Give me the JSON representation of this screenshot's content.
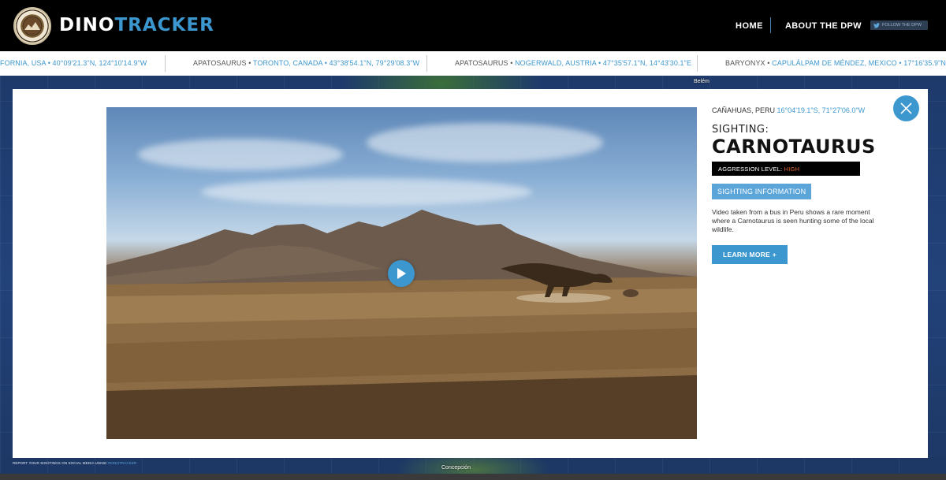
{
  "header": {
    "brand_primary": "DINO",
    "brand_accent": "TRACKER",
    "nav": {
      "home": "HOME",
      "about": "ABOUT THE DPW"
    },
    "follow_label": "FOLLOW THE DPW",
    "seal_text": "DEPARTMENT OF PREHISTORIC WILDLIFE"
  },
  "ticker": [
    {
      "dino": "",
      "location": "FORNIA, USA • 40°09'21.3\"N, 124°10'14.9\"W"
    },
    {
      "dino": "APATOSAURUS •",
      "location": "TORONTO, CANADA • 43°38'54.1\"N, 79°29'08.3\"W"
    },
    {
      "dino": "APATOSAURUS •",
      "location": "NOGERWALD, AUSTRIA • 47°35'57.1\"N, 14°43'30.1\"E"
    },
    {
      "dino": "BARYONYX •",
      "location": "CAPULÁLPAM DE MÉNDEZ, MEXICO • 17°16'35.9\"N, 96°2"
    }
  ],
  "map": {
    "label_top": "Belém",
    "label_bottom": "Concepción"
  },
  "modal": {
    "location": "CAÑAHUAS, PERU",
    "coords": "16°04'19.1\"S, 71°27'06.0\"W",
    "sighting_label": "SIGHTING:",
    "dino_name": "CARNOTAURUS",
    "aggression_label": "AGGRESSION LEVEL:",
    "aggression_value": "HIGH",
    "tab_label": "SIGHTING INFORMATION",
    "description": "Video taken from a bus in Peru shows a rare moment where a Carnotaurus is seen hunting some of the local wildlife.",
    "learn_more": "LEARN MORE +"
  },
  "footer": {
    "social_text": "REPORT YOUR SIGHTINGS ON SOCIAL MEDIA USING",
    "hashtag": "#DINOTRACKER"
  },
  "colors": {
    "accent": "#3d97cf",
    "aggression": "#e0622a",
    "header_bg": "#000000"
  },
  "icons": {
    "play": "play-icon",
    "close": "close-icon",
    "twitter": "twitter-icon",
    "seal": "seal-logo"
  }
}
